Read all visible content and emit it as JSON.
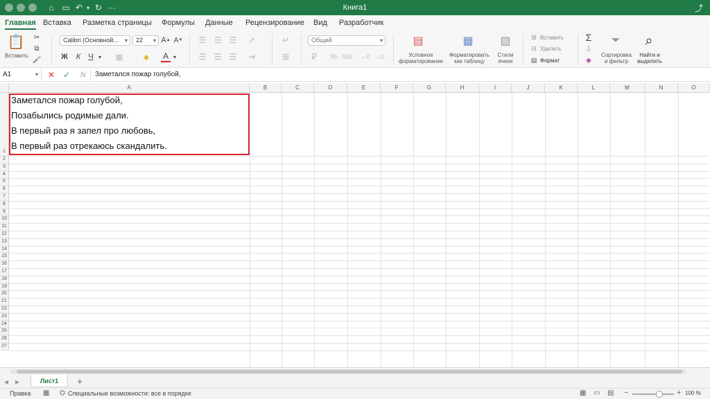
{
  "window": {
    "title": "Книга1"
  },
  "menu": {
    "tabs": [
      "Главная",
      "Вставка",
      "Разметка страницы",
      "Формулы",
      "Данные",
      "Рецензирование",
      "Вид",
      "Разработчик"
    ],
    "active": "Главная"
  },
  "ribbon": {
    "paste_label": "Вставить",
    "font_name": "Calibri (Основной...",
    "font_size": "22",
    "bold": "Ж",
    "italic": "К",
    "underline": "Ч",
    "number_format": "Общий",
    "percent": "%",
    "cond_format_l1": "Условное",
    "cond_format_l2": "форматирование",
    "fmt_table_l1": "Форматировать",
    "fmt_table_l2": "как таблицу",
    "styles_l1": "Стили",
    "styles_l2": "ячеек",
    "insert": "Вставить",
    "delete": "Удалить",
    "format": "Формат",
    "sort_l1": "Сортировка",
    "sort_l2": "и фильтр",
    "find_l1": "Найти и",
    "find_l2": "выделить",
    "sum": "Σ"
  },
  "formula_bar": {
    "name_box": "A1",
    "fx": "fx",
    "content": "Заметался пожар голубой,"
  },
  "columns": [
    "A",
    "B",
    "C",
    "D",
    "E",
    "F",
    "G",
    "H",
    "I",
    "J",
    "K",
    "L",
    "M",
    "N",
    "O"
  ],
  "rows": [
    "1",
    "2",
    "3",
    "4",
    "5",
    "6",
    "7",
    "8",
    "9",
    "10",
    "11",
    "12",
    "13",
    "14",
    "15",
    "16",
    "17",
    "18",
    "19",
    "20",
    "21",
    "22",
    "23",
    "24",
    "25",
    "26",
    "27"
  ],
  "cell_a1_lines": [
    "Заметался пожар голубой,",
    "Позабылись родимые дали.",
    "В первый раз я запел про любовь,",
    "В первый раз отрекаюсь скандалить."
  ],
  "sheets": {
    "tabs": [
      "Лист1"
    ],
    "add": "+"
  },
  "status": {
    "mode": "Правка",
    "accessibility": "Специальные возможности: все в порядке",
    "zoom": "100 %"
  },
  "colors": {
    "brand": "#1f7a45",
    "selection": "#d9262c"
  }
}
